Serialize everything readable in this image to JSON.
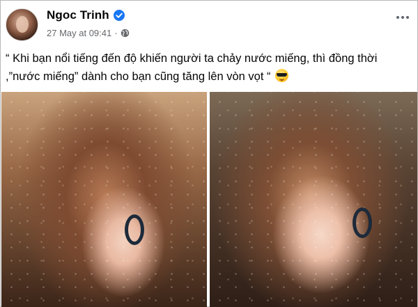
{
  "post": {
    "author_name": "Ngoc Trinh",
    "timestamp": "27 May at 09:41",
    "caption": "“ Khi bạn nổi tiếng đến độ khiến người ta chảy nước miếng, thì đồng thời ,”nước miếng” dành cho bạn cũng tăng lên vòn vọt “",
    "emoji": "smiling-face-with-sunglasses",
    "photos": [
      {
        "name": "selfie-photo-1"
      },
      {
        "name": "selfie-photo-2"
      }
    ]
  },
  "colors": {
    "name_text": "#050505",
    "meta_text": "#65676b",
    "verified_badge": "#1877f2"
  }
}
